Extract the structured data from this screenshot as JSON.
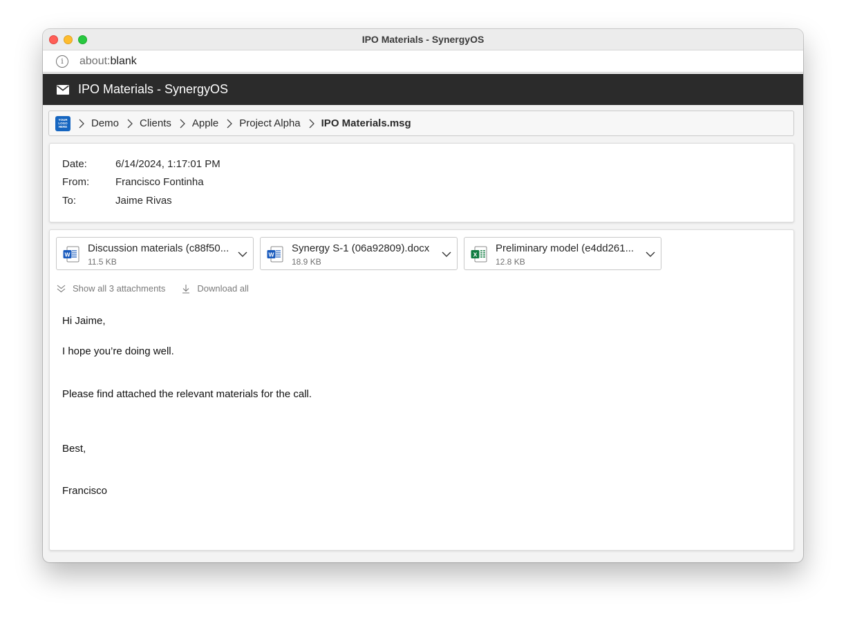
{
  "window": {
    "title": "IPO Materials - SynergyOS"
  },
  "address": {
    "scheme": "about:",
    "rest": "blank"
  },
  "app_header": {
    "title": "IPO Materials - SynergyOS",
    "icon": "mail-icon"
  },
  "breadcrumb": {
    "logo_lines": [
      "YOUR",
      "LOGO",
      "HERE"
    ],
    "items": [
      "Demo",
      "Clients",
      "Apple",
      "Project Alpha",
      "IPO Materials.msg"
    ]
  },
  "email": {
    "date_label": "Date:",
    "date": "6/14/2024, 1:17:01 PM",
    "from_label": "From:",
    "from": "Francisco Fontinha",
    "to_label": "To:",
    "to": "Jaime Rivas"
  },
  "attachments": [
    {
      "name": "Discussion materials (c88f50...",
      "size": "11.5 KB",
      "type": "word",
      "icon": "word-file-icon"
    },
    {
      "name": "Synergy S-1 (06a92809).docx",
      "size": "18.9 KB",
      "type": "word",
      "icon": "word-file-icon"
    },
    {
      "name": "Preliminary model (e4dd261...",
      "size": "12.8 KB",
      "type": "excel",
      "icon": "excel-file-icon"
    }
  ],
  "attachment_actions": {
    "show_all": "Show all 3 attachments",
    "download_all": "Download all"
  },
  "body": {
    "greeting": "Hi Jaime,",
    "line1": "I hope you’re doing well.",
    "line2": "Please find attached the relevant materials for the call.",
    "signoff": "Best,",
    "signature": "Francisco"
  },
  "colors": {
    "header_bg": "#2b2b2b",
    "word_blue": "#185abd",
    "excel_green": "#107c41",
    "logo_blue": "#1565c0"
  }
}
